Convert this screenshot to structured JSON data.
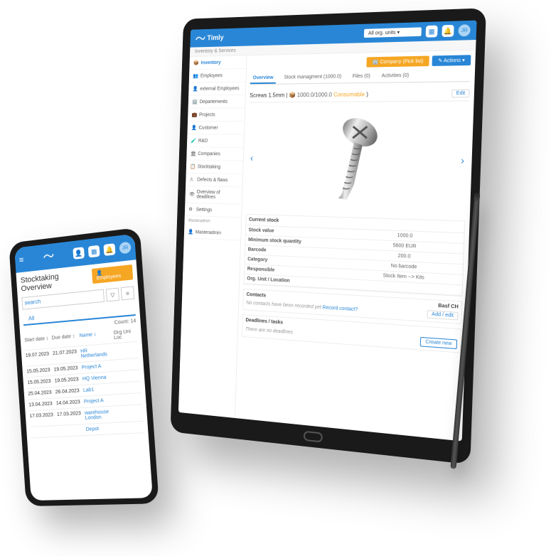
{
  "brand": "Timly",
  "phone": {
    "avatar": "JR",
    "title": "Stocktaking Overview",
    "employees_btn": "Employees",
    "search_placeholder": "search",
    "tab_all": "All",
    "count_label": "Count: 14",
    "columns": {
      "start": "Start date",
      "due": "Due date",
      "name": "Name",
      "org": "Org Uni Loc"
    },
    "rows": [
      {
        "start": "19.07.2023",
        "due": "21.07.2023",
        "name": "HR Netherlands"
      },
      {
        "start": "15.05.2023",
        "due": "19.05.2023",
        "name": "Project A"
      },
      {
        "start": "15.05.2023",
        "due": "19.05.2023",
        "name": "HQ Vienna"
      },
      {
        "start": "25.04.2023",
        "due": "26.04.2023",
        "name": "Lab1"
      },
      {
        "start": "13.04.2023",
        "due": "14.04.2023",
        "name": "Project A"
      },
      {
        "start": "17.03.2023",
        "due": "17.03.2023",
        "name": "warehouse London"
      },
      {
        "start": "",
        "due": "",
        "name": "Depot"
      }
    ]
  },
  "tablet": {
    "breadcrumb": "Inventory & Services",
    "org_select": "All org. units",
    "avatar": "JR",
    "company_btn": "Company (Pick list)",
    "actions_btn": "Actions",
    "sidebar": {
      "items": [
        {
          "icon": "📦",
          "label": "Inventory"
        },
        {
          "icon": "👥",
          "label": "Employees"
        },
        {
          "icon": "👤",
          "label": "external Employees"
        },
        {
          "icon": "🏢",
          "label": "Departements"
        },
        {
          "icon": "💼",
          "label": "Projects"
        },
        {
          "icon": "👤",
          "label": "Customer"
        },
        {
          "icon": "🧪",
          "label": "R&D"
        },
        {
          "icon": "🏛",
          "label": "Companies"
        },
        {
          "icon": "📋",
          "label": "Stocktaking"
        },
        {
          "icon": "⚠",
          "label": "Defects & flaws"
        },
        {
          "icon": "👁",
          "label": "Overview of deadlines"
        },
        {
          "icon": "⚙",
          "label": "Settings"
        }
      ],
      "section": "Masteradmin",
      "masteradmin": {
        "icon": "👤",
        "label": "Masteradmin"
      }
    },
    "content_tabs": [
      {
        "label": "Overview",
        "active": true
      },
      {
        "label": "Stock managment (1000.0)"
      },
      {
        "label": "Files (0)"
      },
      {
        "label": "Activities (0)"
      }
    ],
    "item_name": "Screws 1.5mm",
    "item_stock_text": "1000.0/1000.0",
    "consumable_label": "Consumable",
    "edit_label": "Edit",
    "details": {
      "header": "Current stock",
      "rows": [
        {
          "label": "Stock value",
          "value": "1000.0"
        },
        {
          "label": "Minimum stock quantity",
          "value": "5600 EUR"
        },
        {
          "label": "Barcode",
          "value": "200.0"
        },
        {
          "label": "Category",
          "value": "No barcode"
        },
        {
          "label": "Responsible",
          "value": "Stock Item --> Kits"
        },
        {
          "label": "Org. Unit / Location",
          "value": ""
        }
      ]
    },
    "contacts": {
      "header": "Contacts",
      "header_value": "Basf CH",
      "empty": "No contacts have been recorded yet",
      "record_link": "Record contact?",
      "edit_btn": "Add / edit"
    },
    "deadlines": {
      "header": "Deadlines / tasks",
      "empty": "There are no deadlines",
      "create_btn": "Create new"
    }
  }
}
